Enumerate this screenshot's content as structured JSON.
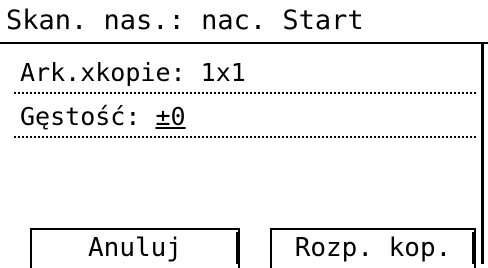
{
  "header": {
    "title": "Skan. nas.: nac. Start"
  },
  "settings": {
    "copies_label": "Ark.xkopie:",
    "copies_value": "1x1",
    "density_label": "Gęstość:",
    "density_value": "±0"
  },
  "softkeys": {
    "cancel_label": "Anuluj",
    "start_copy_label": "Rozp. kop."
  }
}
